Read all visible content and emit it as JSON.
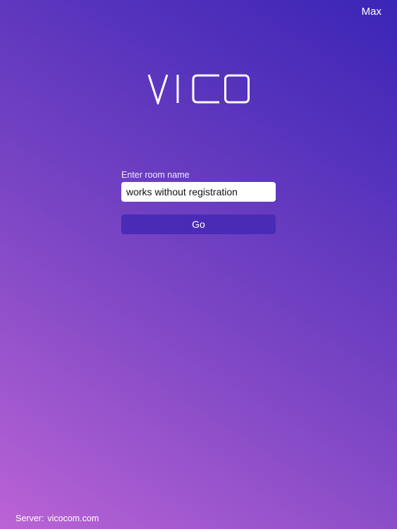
{
  "header": {
    "user_name": "Max"
  },
  "logo": {
    "text": "VICO"
  },
  "room_form": {
    "label": "Enter room name",
    "input_value": "works without registration",
    "go_label": "Go"
  },
  "footer": {
    "server_label": "Server:",
    "server_value": "vicocom.com"
  },
  "colors": {
    "gradient_top_right": "#3b25b6",
    "gradient_bottom_left": "#bb63d6",
    "go_button": "#4a2bb6",
    "input_background": "#ffffff"
  }
}
